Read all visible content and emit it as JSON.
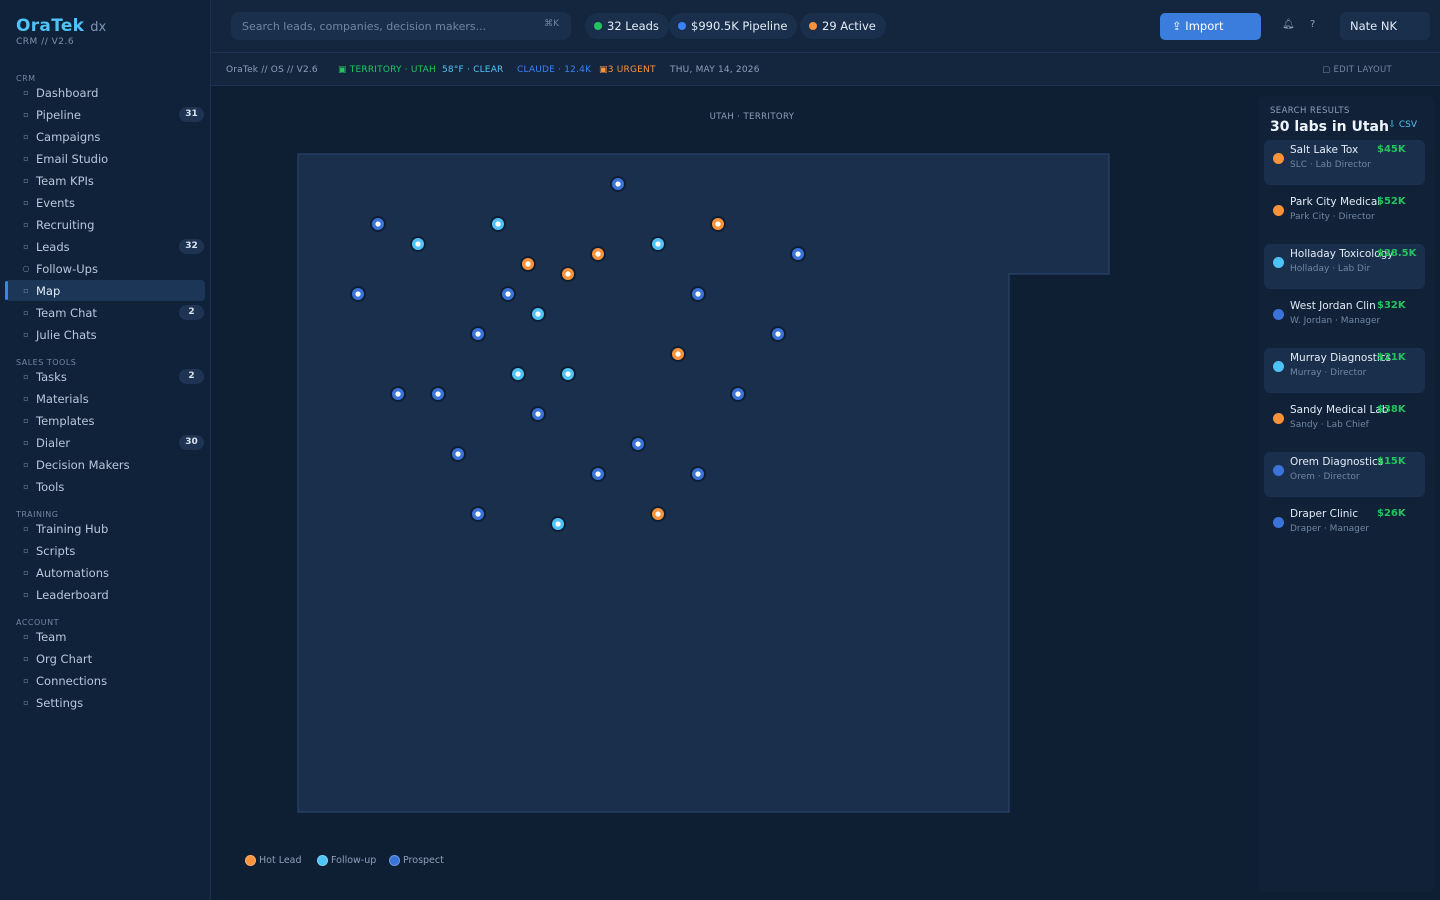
{
  "brand": {
    "name": "OraTek",
    "suffix": "dx",
    "version": "CRM // V2.6"
  },
  "nav": {
    "sections": [
      {
        "title": "CRM",
        "items": [
          {
            "label": "Dashboard",
            "icon": "dashboard-icon"
          },
          {
            "label": "Pipeline",
            "icon": "pipeline-icon",
            "badge": "31"
          },
          {
            "label": "Campaigns",
            "icon": "campaigns-icon"
          },
          {
            "label": "Email Studio",
            "icon": "email-icon"
          },
          {
            "label": "Team KPIs",
            "icon": "kpi-icon"
          },
          {
            "label": "Events",
            "icon": "events-icon"
          },
          {
            "label": "Recruiting",
            "icon": "recruiting-icon"
          },
          {
            "label": "Leads",
            "icon": "leads-icon",
            "badge": "32"
          },
          {
            "label": "Follow-Ups",
            "icon": "follow-ups-icon",
            "glyph": "○"
          },
          {
            "label": "Map",
            "icon": "map-icon",
            "active": true
          },
          {
            "label": "Team Chat",
            "icon": "chat-icon",
            "badge": "2"
          },
          {
            "label": "Julie Chats",
            "icon": "julie-chats-icon"
          }
        ]
      },
      {
        "title": "SALES TOOLS",
        "items": [
          {
            "label": "Tasks",
            "icon": "tasks-icon",
            "badge": "2"
          },
          {
            "label": "Materials",
            "icon": "materials-icon"
          },
          {
            "label": "Templates",
            "icon": "templates-icon"
          },
          {
            "label": "Dialer",
            "icon": "dialer-icon",
            "badge": "30"
          },
          {
            "label": "Decision Makers",
            "icon": "decision-makers-icon"
          },
          {
            "label": "Tools",
            "icon": "tools-icon"
          }
        ]
      },
      {
        "title": "TRAINING",
        "items": [
          {
            "label": "Training Hub",
            "icon": "training-hub-icon"
          },
          {
            "label": "Scripts",
            "icon": "scripts-icon"
          },
          {
            "label": "Automations",
            "icon": "automations-icon"
          },
          {
            "label": "Leaderboard",
            "icon": "leaderboard-icon"
          }
        ]
      },
      {
        "title": "ACCOUNT",
        "items": [
          {
            "label": "Team",
            "icon": "team-icon"
          },
          {
            "label": "Org Chart",
            "icon": "org-chart-icon"
          },
          {
            "label": "Connections",
            "icon": "connections-icon"
          },
          {
            "label": "Settings",
            "icon": "settings-icon"
          }
        ]
      }
    ]
  },
  "topbar": {
    "search_placeholder": "Search leads, companies, decision makers...",
    "search_shortcut": "⌘K",
    "stats": [
      {
        "label": "32 Leads",
        "color": "#22c55e"
      },
      {
        "label": "$990.5K Pipeline",
        "color": "#3b82f6"
      },
      {
        "label": "29 Active",
        "color": "#fb923c"
      }
    ],
    "import_label": "Import",
    "user_label": "Nate  NK"
  },
  "statusbar": {
    "path": "OraTek // OS // V2.6",
    "territory": "TERRITORY · UTAH",
    "weather": "58°F · CLEAR",
    "claude": "CLAUDE · 12.4K",
    "urgent": "3 URGENT",
    "date": "THU, MAY 14, 2026",
    "edit_layout": "EDIT LAYOUT"
  },
  "map": {
    "title": "UTAH · TERRITORY",
    "colors": {
      "hot": "#fb923c",
      "followup": "#4fc3f7",
      "prospect": "#3b74d9"
    },
    "pins": [
      {
        "type": "prospect"
      },
      {
        "type": "prospect"
      },
      {
        "type": "followup"
      },
      {
        "type": "followup"
      },
      {
        "type": "followup"
      },
      {
        "type": "hot"
      },
      {
        "type": "prospect"
      },
      {
        "type": "hot"
      },
      {
        "type": "hot"
      },
      {
        "type": "hot"
      },
      {
        "type": "prospect"
      },
      {
        "type": "prospect"
      },
      {
        "type": "prospect"
      },
      {
        "type": "followup"
      },
      {
        "type": "prospect"
      },
      {
        "type": "prospect"
      },
      {
        "type": "hot"
      },
      {
        "type": "prospect"
      },
      {
        "type": "prospect"
      },
      {
        "type": "followup"
      },
      {
        "type": "followup"
      },
      {
        "type": "prospect"
      },
      {
        "type": "prospect"
      },
      {
        "type": "prospect"
      },
      {
        "type": "prospect"
      },
      {
        "type": "prospect"
      },
      {
        "type": "prospect"
      },
      {
        "type": "prospect"
      },
      {
        "type": "followup"
      },
      {
        "type": "hot"
      }
    ],
    "legend": [
      {
        "label": "Hot Lead",
        "color": "#fb923c"
      },
      {
        "label": "Follow-up",
        "color": "#4fc3f7"
      },
      {
        "label": "Prospect",
        "color": "#3b74d9"
      }
    ]
  },
  "results": {
    "label": "SEARCH RESULTS",
    "title": "30 labs in Utah",
    "csv_label": "CSV",
    "items": [
      {
        "name": "Salt Lake Tox",
        "sub": "SLC · Lab Director",
        "value": "$45K",
        "color": "#fb923c",
        "shaded": true
      },
      {
        "name": "Park City Medical",
        "sub": "Park City · Director",
        "value": "$52K",
        "color": "#fb923c",
        "shaded": false
      },
      {
        "name": "Holladay Toxicology",
        "sub": "Holladay · Lab Dir",
        "value": "$28.5K",
        "color": "#4fc3f7",
        "shaded": true
      },
      {
        "name": "West Jordan Clin",
        "sub": "W. Jordan · Manager",
        "value": "$32K",
        "color": "#3b74d9",
        "shaded": false
      },
      {
        "name": "Murray Diagnostics",
        "sub": "Murray · Director",
        "value": "$21K",
        "color": "#4fc3f7",
        "shaded": true
      },
      {
        "name": "Sandy Medical Lab",
        "sub": "Sandy · Lab Chief",
        "value": "$38K",
        "color": "#fb923c",
        "shaded": false
      },
      {
        "name": "Orem Diagnostics",
        "sub": "Orem · Director",
        "value": "$15K",
        "color": "#3b74d9",
        "shaded": true
      },
      {
        "name": "Draper Clinic",
        "sub": "Draper · Manager",
        "value": "$26K",
        "color": "#3b74d9",
        "shaded": false
      }
    ]
  }
}
